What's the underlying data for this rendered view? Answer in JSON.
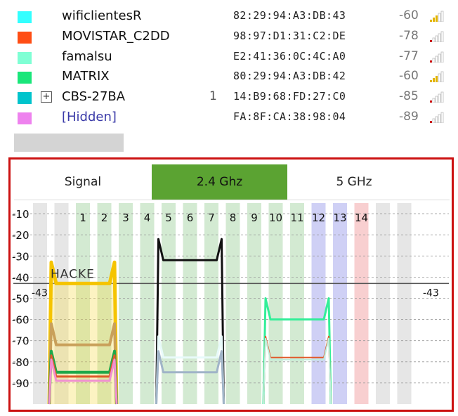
{
  "networks": [
    {
      "ssid": "wificlientesR",
      "count": "",
      "mac": "82:29:94:A3:DB:43",
      "rssi": "-60",
      "color": "#33ffff",
      "bars": 3,
      "bar_color": "#e2b400",
      "expandable": false
    },
    {
      "ssid": "MOVISTAR_C2DD",
      "count": "",
      "mac": "98:97:D1:31:C2:DE",
      "rssi": "-78",
      "color": "#ff4d14",
      "bars": 1,
      "bar_color": "#cc1111",
      "expandable": false
    },
    {
      "ssid": "famalsu",
      "count": "",
      "mac": "E2:41:36:0C:4C:A0",
      "rssi": "-77",
      "color": "#7fffd4",
      "bars": 1,
      "bar_color": "#cc1111",
      "expandable": false
    },
    {
      "ssid": "MATRIX",
      "count": "",
      "mac": "80:29:94:A3:DB:42",
      "rssi": "-60",
      "color": "#19e67a",
      "bars": 3,
      "bar_color": "#e2b400",
      "expandable": false
    },
    {
      "ssid": "CBS-27BA",
      "count": "1",
      "mac": "14:B9:68:FD:27:C0",
      "rssi": "-85",
      "color": "#00c4cc",
      "bars": 1,
      "bar_color": "#cc1111",
      "expandable": true
    },
    {
      "ssid": "[Hidden]",
      "count": "",
      "mac": "FA:8F:CA:38:98:04",
      "rssi": "-89",
      "color": "#ee82ee",
      "bars": 1,
      "bar_color": "#cc1111",
      "expandable": false,
      "hidden": true
    }
  ],
  "tabs": {
    "signal": "Signal",
    "ghz24": "2.4 Ghz",
    "ghz5": "5 GHz",
    "active": "ghz24"
  },
  "chart": {
    "y_ticks": [
      "-10",
      "-20",
      "-30",
      "-40",
      "-50",
      "-60",
      "-70",
      "-80",
      "-90"
    ],
    "channels": [
      "1",
      "2",
      "3",
      "4",
      "5",
      "6",
      "7",
      "8",
      "9",
      "10",
      "11",
      "12",
      "13",
      "14"
    ],
    "threshold_value": -43,
    "threshold_label_left": "-43",
    "threshold_label_right": "-43",
    "network_label": "HACKE"
  },
  "chart_data": {
    "type": "area",
    "ylim": [
      -100,
      -5
    ],
    "xlim": [
      -1,
      17
    ],
    "y_ticks": [
      -10,
      -20,
      -30,
      -40,
      -50,
      -60,
      -70,
      -80,
      -90
    ],
    "channel_numbers": [
      1,
      2,
      3,
      4,
      5,
      6,
      7,
      8,
      9,
      10,
      11,
      12,
      13,
      14
    ],
    "threshold": -43,
    "channel_highlight": {
      "green": [
        1,
        2,
        3,
        4,
        5,
        6,
        7,
        8,
        9,
        10,
        11
      ],
      "blue": [
        12,
        13
      ],
      "red": [
        14
      ]
    },
    "series": [
      {
        "name": "HACKE",
        "channel": 1,
        "value": -43,
        "color": "#f5c400",
        "stroke": 5,
        "fill": true
      },
      {
        "channel": 1,
        "value": -72,
        "color": "#c9a05a",
        "stroke": 4
      },
      {
        "channel": 1,
        "value": -85,
        "color": "#1fa84a",
        "stroke": 4
      },
      {
        "channel": 1,
        "value": -87,
        "color": "#e05a2a",
        "stroke": 3
      },
      {
        "channel": 1,
        "value": -89,
        "color": "#f090d0",
        "stroke": 3
      },
      {
        "channel": 6,
        "value": -32,
        "color": "#111111",
        "stroke": 3
      },
      {
        "channel": 6,
        "value": -78,
        "color": "#e8fafa",
        "stroke": 3
      },
      {
        "channel": 6,
        "value": -85,
        "color": "#a0b4c8",
        "stroke": 3
      },
      {
        "channel": 11,
        "value": -60,
        "color": "#33ee99",
        "stroke": 3
      },
      {
        "channel": 11,
        "value": -78,
        "color": "#e05a2a",
        "stroke": 2
      },
      {
        "channel": 11,
        "value": -79,
        "color": "#bfeedd",
        "stroke": 2
      }
    ]
  }
}
